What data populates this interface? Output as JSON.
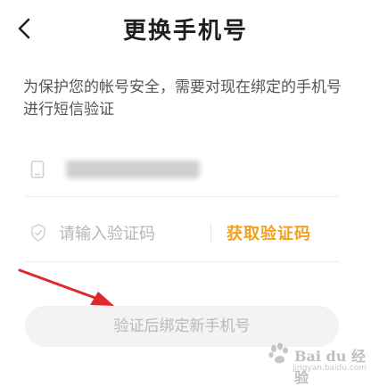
{
  "header": {
    "title": "更换手机号",
    "back_icon": "chevron-left-icon"
  },
  "description": "为保护您的帐号安全，需要对现在绑定的手机号进行短信验证",
  "phone": {
    "icon": "phone-icon",
    "value_hidden": true
  },
  "code": {
    "icon": "shield-check-icon",
    "placeholder": "请输入验证码",
    "get_code_label": "获取验证码"
  },
  "submit": {
    "label": "验证后绑定新手机号"
  },
  "watermark": {
    "brand": "Bai du 经验",
    "url": "jingyan.baidu.com"
  },
  "colors": {
    "accent": "#f2a01e",
    "arrow": "#e0282b",
    "disabled_bg": "#f3f3f3",
    "disabled_text": "#b9b9b9"
  }
}
